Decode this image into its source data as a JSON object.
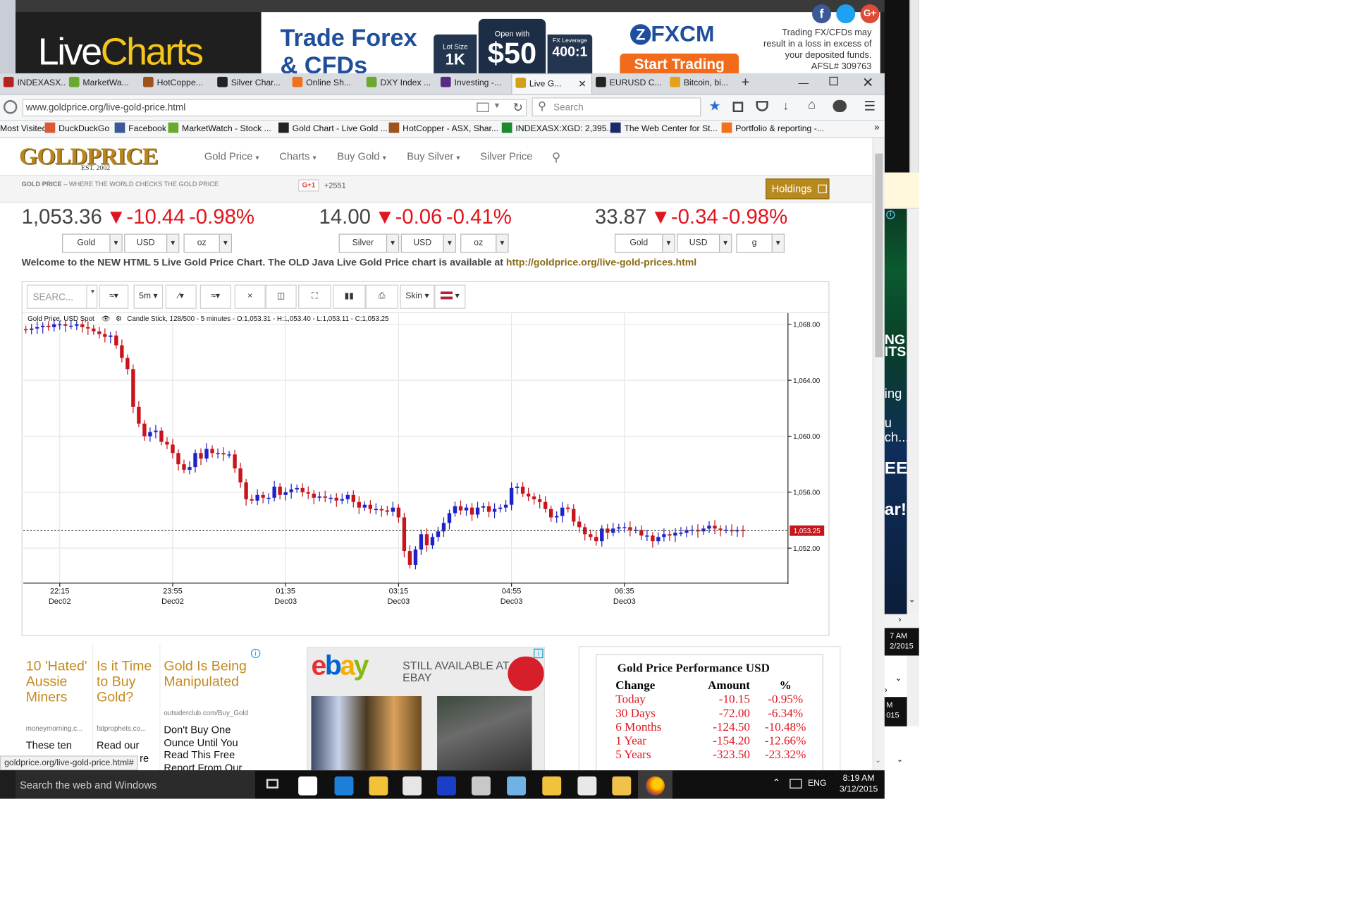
{
  "banner": {
    "logo_live": "Live",
    "logo_charts": "Charts",
    "ad_title_line1": "Trade Forex",
    "ad_title_line2": "& CFDs",
    "lot_label": "Lot Size",
    "lot_value": "1K",
    "open_label": "Open with",
    "open_value": "$50",
    "lev_label": "FX Leverage",
    "lev_value": "400:1",
    "brand": "FXCM",
    "cta": "Start Trading",
    "disclaimer": "Trading FX/CFDs may result in a loss in excess of your deposited funds. AFSL# 309763"
  },
  "browser": {
    "tabs": [
      {
        "label": "INDEXASX...",
        "color": "#b2251f"
      },
      {
        "label": "MarketWa...",
        "color": "#6aa92e"
      },
      {
        "label": "HotCoppe...",
        "color": "#a0521d"
      },
      {
        "label": "Silver Char...",
        "color": "#222222"
      },
      {
        "label": "Online Sh...",
        "color": "#f2711c"
      },
      {
        "label": "DXY Index ...",
        "color": "#6aa92e"
      },
      {
        "label": "Investing -...",
        "color": "#5b2a86"
      },
      {
        "label": "Live G...",
        "color": "#d4a017"
      },
      {
        "label": "EURUSD C...",
        "color": "#222222"
      },
      {
        "label": "Bitcoin, bi...",
        "color": "#e3a21a"
      }
    ],
    "new_tab": "+",
    "url": "www.goldprice.org/live-gold-price.html",
    "search_placeholder": "Search",
    "bookmarks": [
      "Most Visited",
      "DuckDuckGo",
      "Facebook",
      "MarketWatch - Stock ...",
      "Gold Chart - Live Gold ...",
      "HotCopper - ASX, Shar...",
      "INDEXASX:XGD: 2,395....",
      "The Web Center for St...",
      "Portfolio & reporting -..."
    ],
    "status_url": "goldprice.org/live-gold-price.html#"
  },
  "site": {
    "logo": "GOLDPRICE",
    "est": "EST. 2002",
    "nav": [
      "Gold Price",
      "Charts",
      "Buy Gold",
      "Buy Silver",
      "Silver Price"
    ],
    "tagline_strong": "GOLD PRICE",
    "tagline": " – WHERE THE WORLD CHECKS THE GOLD PRICE",
    "gplus": "G+1",
    "gplus_count": "+2551",
    "holdings": "Holdings",
    "prices": [
      {
        "price": "1,053.36",
        "change": "-10.44",
        "pct": "-0.98%",
        "sel1": "Gold",
        "sel2": "USD",
        "sel3": "oz"
      },
      {
        "price": "14.00",
        "change": "-0.06",
        "pct": "-0.41%",
        "sel1": "Silver",
        "sel2": "USD",
        "sel3": "oz"
      },
      {
        "price": "33.87",
        "change": "-0.34",
        "pct": "-0.98%",
        "sel1": "Gold",
        "sel2": "USD",
        "sel3": "g"
      }
    ],
    "welcome": "Welcome to the NEW HTML 5 Live Gold Price Chart. The OLD Java Live Gold Price chart is available at ",
    "welcome_link": "http://goldprice.org/live-gold-prices.html"
  },
  "toolbar": {
    "search": "SEARC...",
    "interval": "5m",
    "skin": "Skin"
  },
  "chart_info": {
    "series_name": "Gold Price, USD Spot",
    "info": "Candle Stick, 128/500 - 5 minutes - O:1,053.31 - H:1,053.40 - L:1,053.11 - C:1,053.25"
  },
  "chart_data": {
    "type": "candlestick",
    "ylim": [
      1049.5,
      1068.8
    ],
    "y_ticks": [
      "1,068.00",
      "1,064.00",
      "1,060.00",
      "1,056.00",
      "1,052.00"
    ],
    "y_tick_values": [
      1068,
      1064,
      1060,
      1056,
      1052
    ],
    "last": "1,053.25",
    "last_value": 1053.25,
    "x_ticks": [
      {
        "time": "22:15",
        "date": "Dec02",
        "index": 6
      },
      {
        "time": "23:55",
        "date": "Dec02",
        "index": 26
      },
      {
        "time": "01:35",
        "date": "Dec03",
        "index": 46
      },
      {
        "time": "03:15",
        "date": "Dec03",
        "index": 66
      },
      {
        "time": "04:55",
        "date": "Dec03",
        "index": 86
      },
      {
        "time": "06:35",
        "date": "Dec03",
        "index": 106
      }
    ],
    "colors": {
      "up": "#1f22c8",
      "down": "#c8151c"
    },
    "closes": [
      1067.6,
      1067.7,
      1067.8,
      1067.9,
      1067.8,
      1068.0,
      1068.0,
      1067.9,
      1067.9,
      1068.0,
      1067.8,
      1067.7,
      1067.5,
      1067.3,
      1067.1,
      1067.2,
      1066.5,
      1065.6,
      1064.8,
      1062.1,
      1060.9,
      1060.0,
      1060.3,
      1060.4,
      1059.6,
      1059.4,
      1058.8,
      1058.0,
      1057.6,
      1057.8,
      1058.8,
      1058.4,
      1059.1,
      1058.8,
      1058.8,
      1058.7,
      1058.7,
      1057.7,
      1056.7,
      1055.5,
      1055.4,
      1055.8,
      1055.6,
      1055.6,
      1056.4,
      1055.8,
      1056.0,
      1056.2,
      1056.3,
      1056.0,
      1055.9,
      1055.6,
      1055.7,
      1055.6,
      1055.6,
      1055.4,
      1055.5,
      1055.8,
      1055.3,
      1054.9,
      1055.1,
      1054.8,
      1054.8,
      1054.7,
      1054.6,
      1054.9,
      1054.2,
      1051.8,
      1050.8,
      1051.9,
      1053.0,
      1052.2,
      1052.8,
      1053.2,
      1053.8,
      1054.5,
      1055.0,
      1054.7,
      1054.9,
      1054.4,
      1054.9,
      1055.0,
      1054.6,
      1054.8,
      1054.9,
      1055.1,
      1056.3,
      1056.4,
      1055.9,
      1055.7,
      1055.5,
      1055.3,
      1054.8,
      1054.2,
      1054.3,
      1054.9,
      1054.8,
      1053.9,
      1053.5,
      1053.0,
      1052.8,
      1052.5,
      1053.4,
      1053.1,
      1053.4,
      1053.5,
      1053.5,
      1053.3,
      1053.3,
      1052.9,
      1052.9,
      1052.5,
      1052.8,
      1053.0,
      1052.9,
      1053.1,
      1053.1,
      1053.3,
      1053.3,
      1053.2,
      1053.4,
      1053.6,
      1053.4,
      1053.3,
      1053.3,
      1053.2,
      1053.3,
      1053.25
    ]
  },
  "ads": {
    "col1_title": "10 'Hated' Aussie Miners",
    "col1_src": "moneymorning.c...",
    "col1_body": "These ten",
    "col2_title": "Is it Time to Buy Gold?",
    "col2_src": "fatprophets.co...",
    "col2_body": "Read our",
    "col2_body2": "re",
    "col3_title": "Gold Is Being Manipulated",
    "col3_src": "outsiderclub.com/Buy_Gold",
    "col3_body": "Don't Buy One Ounce Until You Read This Free Report From Our",
    "ebay_logo": "ebay",
    "ebay_text": "STILL AVAILABLE AT EBAY"
  },
  "performance": {
    "title": "Gold Price Performance USD",
    "headers": [
      "Change",
      "Amount",
      "%"
    ],
    "rows": [
      [
        "Today",
        "-10.15",
        "-0.95%"
      ],
      [
        "30 Days",
        "-72.00",
        "-6.34%"
      ],
      [
        "6 Months",
        "-124.50",
        "-10.48%"
      ],
      [
        "1 Year",
        "-154.20",
        "-12.66%"
      ],
      [
        "5 Years",
        "-323.50",
        "-23.32%"
      ]
    ]
  },
  "side": {
    "time1": "7 AM",
    "date1": "2/2015",
    "time2": "M",
    "date2": "015",
    "text_ng": "NG",
    "text_its": "ITS",
    "text_ing": "ing",
    "text_u": "u",
    "text_ch": "ch...",
    "text_ee": "EE",
    "text_ar": "ar!"
  },
  "taskbar": {
    "search": "Search the web and Windows",
    "lang": "ENG",
    "time": "8:19 AM",
    "date": "3/12/2015"
  }
}
